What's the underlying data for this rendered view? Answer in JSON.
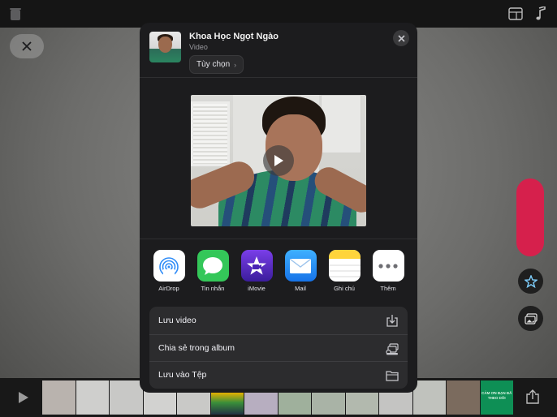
{
  "sheet": {
    "title": "Khoa Học Ngọt Ngào",
    "subtitle": "Video",
    "options_label": "Tùy chọn"
  },
  "apps": [
    {
      "label": "AirDrop",
      "icon": "airdrop-icon",
      "color": "#ffffff"
    },
    {
      "label": "Tin nhắn",
      "icon": "messages-icon",
      "color": "#34c759"
    },
    {
      "label": "iMovie",
      "icon": "imovie-icon",
      "color": "#5b2fc4"
    },
    {
      "label": "Mail",
      "icon": "mail-icon",
      "color": "#1e88f5"
    },
    {
      "label": "Ghi chú",
      "icon": "notes-icon",
      "color": "#ffd43b"
    },
    {
      "label": "Thêm",
      "icon": "more-icon",
      "color": "#ffffff"
    }
  ],
  "actions": [
    {
      "label": "Lưu video",
      "icon": "save-download-icon"
    },
    {
      "label": "Chia sẻ trong album",
      "icon": "shared-album-icon"
    },
    {
      "label": "Lưu vào Tệp",
      "icon": "folder-icon"
    }
  ],
  "background": {
    "end_card_text": "CẢM ƠN BẠN ĐÃ THEO DÕI",
    "record_color": "#d6204c"
  }
}
